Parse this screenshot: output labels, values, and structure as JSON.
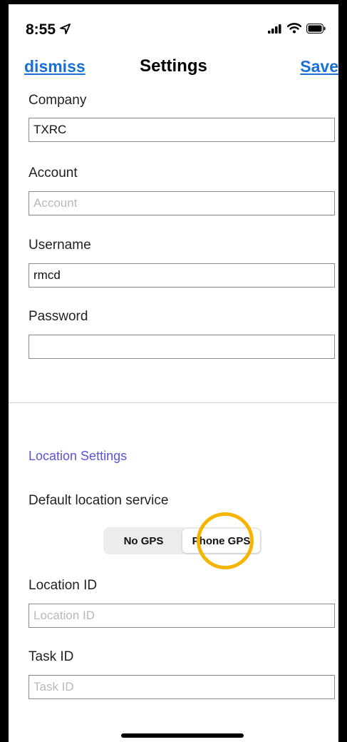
{
  "status_bar": {
    "time": "8:55",
    "location_icon": "location-arrow-icon",
    "signal_icon": "cellular-signal-icon",
    "wifi_icon": "wifi-icon",
    "battery_icon": "battery-icon"
  },
  "nav": {
    "dismiss_label": "dismiss",
    "title": "Settings",
    "save_label": "Save"
  },
  "form": {
    "company": {
      "label": "Company",
      "value": "TXRC",
      "placeholder": ""
    },
    "account": {
      "label": "Account",
      "value": "",
      "placeholder": "Account"
    },
    "username": {
      "label": "Username",
      "value": "rmcd",
      "placeholder": ""
    },
    "password": {
      "label": "Password",
      "value": "",
      "placeholder": ""
    }
  },
  "location": {
    "section_title": "Location Settings",
    "default_service_label": "Default location service",
    "options": [
      "No GPS",
      "Phone GPS"
    ],
    "selected": "Phone GPS",
    "location_id": {
      "label": "Location ID",
      "value": "",
      "placeholder": "Location ID"
    },
    "task_id": {
      "label": "Task ID",
      "value": "",
      "placeholder": "Task ID"
    }
  },
  "colors": {
    "link_blue": "#1a6ed8",
    "section_purple": "#5a54d6",
    "highlight_ring": "#f5b400"
  }
}
